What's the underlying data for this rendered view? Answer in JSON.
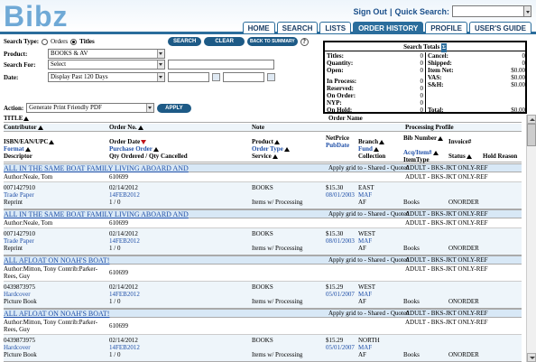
{
  "app": {
    "logo": "Bibz"
  },
  "header": {
    "sign_out": "Sign Out",
    "separator": "|",
    "quick_search_label": "Quick Search:",
    "tabs": [
      {
        "label": "HOME",
        "active": false
      },
      {
        "label": "SEARCH",
        "active": false
      },
      {
        "label": "LISTS",
        "active": false
      },
      {
        "label": "ORDER HISTORY",
        "active": true
      },
      {
        "label": "PROFILE",
        "active": false
      },
      {
        "label": "USER'S GUIDE",
        "active": false
      }
    ]
  },
  "form": {
    "search_type_label": "Search Type:",
    "orders_label": "Orders",
    "titles_label": "Titles",
    "search_type_selected": "Titles",
    "search_button": "SEARCH",
    "clear_button": "CLEAR",
    "back_button": "BACK TO SUMMARY",
    "help": "?",
    "product_label": "Product:",
    "product_value": "BOOKS & AV",
    "search_for_label": "Search For:",
    "search_for_value": "Select",
    "date_label": "Date:",
    "date_value": "Display Past 120 Days",
    "action_label": "Action:",
    "action_value": "Generate Print Friendly PDF",
    "apply_button": "APPLY"
  },
  "totals": {
    "title": "Search Totals",
    "sigma": "Σ",
    "left": [
      {
        "label": "Titles:",
        "value": "0"
      },
      {
        "label": "Quantity:",
        "value": "0"
      },
      {
        "label": "Open:",
        "value": "0"
      },
      {
        "label": "In Process:",
        "value": "0"
      },
      {
        "label": "Reserved:",
        "value": "0"
      },
      {
        "label": "On Order:",
        "value": "0"
      },
      {
        "label": "NYP:",
        "value": "0"
      },
      {
        "label": "On Hold:",
        "value": "0"
      }
    ],
    "right": [
      {
        "label": "Cancel:",
        "value": "0"
      },
      {
        "label": "Shipped:",
        "value": "0"
      },
      {
        "label": "Item Net:",
        "value": "$0.00"
      },
      {
        "label": "VAS:",
        "value": "$0.00"
      },
      {
        "label": "S&H:",
        "value": "$0.00"
      },
      {
        "label": "Total:",
        "value": "$0.00"
      }
    ]
  },
  "columns": {
    "title": "TITLE",
    "order_name": "Order Name",
    "contributor": "Contributor",
    "order_no": "Order No.",
    "note": "Note",
    "processing_profile": "Processing Profile",
    "isbn": "ISBN/EAN/UPC",
    "format": "Format",
    "descriptor": "Descriptor",
    "order_date": "Order Date",
    "purchase_order": "Purchase Order",
    "qty": "Qty Ordered / Qty Cancelled",
    "product": "Product",
    "order_type": "Order Type",
    "service": "Service",
    "net_price": "NetPrice",
    "pub_date": "PubDate",
    "branch": "Branch",
    "fund": "Fund",
    "collection": "Collection",
    "bib_number": "Bib Number",
    "acq_item": "Acq/Item#",
    "item_type": "ItemType",
    "invoice": "Invoice#",
    "status": "Status",
    "hold_reason": "Hold Reason"
  },
  "records": [
    {
      "title": "ALL IN THE SAME BOAT FAMILY LIVING ABOARD AND",
      "grid": "Apply grid to - Shared - Quoted",
      "ref": "ADULT - BKS-JKT ONLY-REF",
      "author": "Author:Neale, Tom",
      "order_no": "610699",
      "isbn": "0071427910",
      "format": "Trade Paper",
      "descriptor": "Reprint",
      "order_date": "02/14/2012",
      "purchase_order": "14FEB2012",
      "qty": "1 / 0",
      "product": "BOOKS",
      "service": "Items w/ Processing",
      "price": "$15.30",
      "pub_date": "08/01/2003",
      "branch": "EAST",
      "fund": "MAF",
      "collection": "AF",
      "item_type": "Books",
      "status": "ONORDER"
    },
    {
      "title": "ALL IN THE SAME BOAT FAMILY LIVING ABOARD AND",
      "grid": "Apply grid to - Shared - Quoted",
      "ref": "ADULT - BKS-JKT ONLY-REF",
      "author": "Author:Neale, Tom",
      "order_no": "610699",
      "isbn": "0071427910",
      "format": "Trade Paper",
      "descriptor": "Reprint",
      "order_date": "02/14/2012",
      "purchase_order": "14FEB2012",
      "qty": "1 / 0",
      "product": "BOOKS",
      "service": "Items w/ Processing",
      "price": "$15.30",
      "pub_date": "08/01/2003",
      "branch": "WEST",
      "fund": "MAF",
      "collection": "AF",
      "item_type": "Books",
      "status": "ONORDER"
    },
    {
      "title": "ALL AFLOAT ON NOAH'S BOAT!",
      "grid": "Apply grid to - Shared - Quoted",
      "ref": "ADULT - BKS-JKT ONLY-REF",
      "author": "Author:Mitton, Tony Contrib:Parker-Rees, Guy",
      "order_no": "610699",
      "isbn": "0439873975",
      "format": "Hardcover",
      "descriptor": "Picture Book",
      "order_date": "02/14/2012",
      "purchase_order": "14FEB2012",
      "qty": "1 / 0",
      "product": "BOOKS",
      "service": "Items w/ Processing",
      "price": "$15.29",
      "pub_date": "05/01/2007",
      "branch": "WEST",
      "fund": "MAF",
      "collection": "AF",
      "item_type": "Books",
      "status": "ONORDER"
    },
    {
      "title": "ALL AFLOAT ON NOAH'S BOAT!",
      "grid": "Apply grid to - Shared - Quoted",
      "ref": "ADULT - BKS-JKT ONLY-REF",
      "author": "Author:Mitton, Tony Contrib:Parker-Rees, Guy",
      "order_no": "610699",
      "isbn": "0439873975",
      "format": "Hardcover",
      "descriptor": "Picture Book",
      "order_date": "02/14/2012",
      "purchase_order": "14FEB2012",
      "qty": "1 / 0",
      "product": "BOOKS",
      "service": "Items w/ Processing",
      "price": "$15.29",
      "pub_date": "05/01/2007",
      "branch": "NORTH",
      "fund": "MAF",
      "collection": "AF",
      "item_type": "Books",
      "status": "ONORDER"
    }
  ]
}
